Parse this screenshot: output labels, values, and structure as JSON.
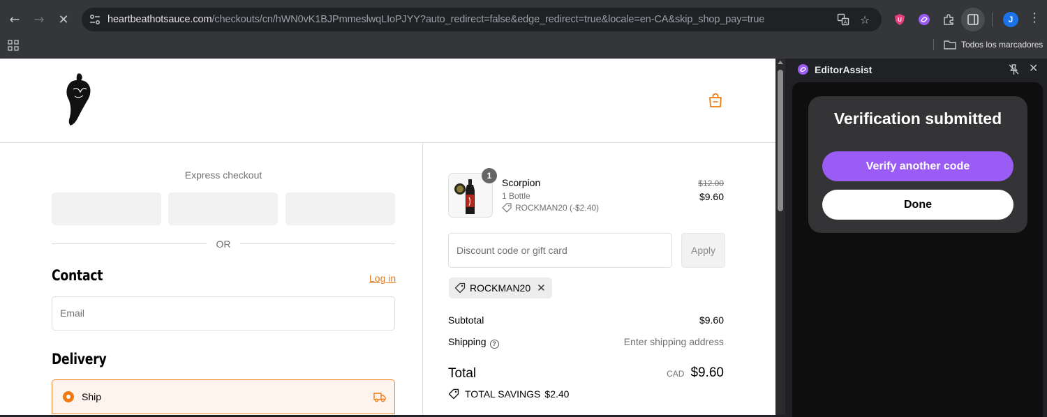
{
  "browser": {
    "url_host": "heartbeathotsauce.com",
    "url_rest": "/checkouts/cn/hWN0vK1BJPmmeslwqLIoPJYY?auto_redirect=false&edge_redirect=true&locale=en-CA&skip_shop_pay=true",
    "bookmarks_label": "Todos los marcadores",
    "avatar_initial": "J"
  },
  "checkout": {
    "express_title": "Express checkout",
    "or_label": "OR",
    "contact_title": "Contact",
    "login_link": "Log in",
    "email_placeholder": "Email",
    "delivery_title": "Delivery",
    "ship_option": "Ship"
  },
  "summary": {
    "product": {
      "name": "Scorpion",
      "variant": "1 Bottle",
      "discount": "ROCKMAN20 (-$2.40)",
      "original_price": "$12.00",
      "price": "$9.60",
      "quantity": "1"
    },
    "discount_placeholder": "Discount code or gift card",
    "apply_label": "Apply",
    "applied_code": "ROCKMAN20",
    "subtotal_label": "Subtotal",
    "subtotal_value": "$9.60",
    "shipping_label": "Shipping",
    "shipping_value": "Enter shipping address",
    "total_label": "Total",
    "total_currency": "CAD",
    "total_value": "$9.60",
    "savings_label": "TOTAL SAVINGS",
    "savings_value": "$2.40"
  },
  "side_panel": {
    "title": "EditorAssist",
    "card_title": "Verification submitted",
    "verify_button": "Verify another code",
    "done_button": "Done"
  },
  "colors": {
    "accent_orange": "#f07a12",
    "purple": "#9b5cf6"
  }
}
